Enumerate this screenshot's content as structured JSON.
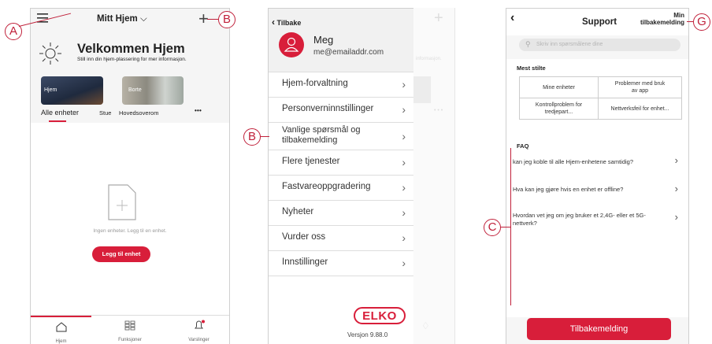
{
  "callouts": {
    "a": "A",
    "b1": "B",
    "b2": "B",
    "c": "C",
    "g": "G"
  },
  "screen1": {
    "home_selector": "Mitt Hjem",
    "welcome_title": "Velkommen Hjem",
    "welcome_sub": "Still inn din hjem-plassering for mer informasjon.",
    "card_home": "Hjem",
    "card_away": "Borte",
    "tabs": [
      "Alle enheter",
      "Stue",
      "Hovedsoverom"
    ],
    "more": "• • •",
    "empty_text": "Ingen enheter. Legg til en enhet.",
    "add_button": "Legg til enhet",
    "nav": [
      "Hjem",
      "Funksjoner",
      "Varslinger"
    ],
    "accent": "#d81e3a"
  },
  "screen2": {
    "back_label": "Tilbake",
    "user_name": "Meg",
    "user_email": "me@emailaddr.com",
    "menu": [
      "Hjem-forvaltning",
      "Personverninnstillinger",
      "Vanlige spørsmål og tilbakemelding",
      "Flere tjenester",
      "Fastvareoppgradering",
      "Nyheter",
      "Vurder oss",
      "Innstillinger"
    ],
    "logo": "ELKO",
    "version": "Versjon 9.88.0",
    "bg_text": "informasjon."
  },
  "screen3": {
    "title": "Support",
    "feedback_link": "Min tilbakemelding",
    "search_placeholder": "Skriv inn spørsmålene dine",
    "most_asked_title": "Mest stilte",
    "grid": [
      "Mine enheter",
      "Problemer med bruk av app",
      "Kontrollproblem for tredjepart...",
      "Nettverksfeil for enhet..."
    ],
    "faq_title": "FAQ",
    "faq": [
      "kan jeg koble til alle Hjem-enhetene samtidig?",
      "Hva kan jeg gjøre hvis en enhet er offline?",
      "Hvordan vet jeg om jeg bruker et 2,4G- eller et 5G-nettverk?"
    ],
    "feedback_button": "Tilbakemelding"
  }
}
